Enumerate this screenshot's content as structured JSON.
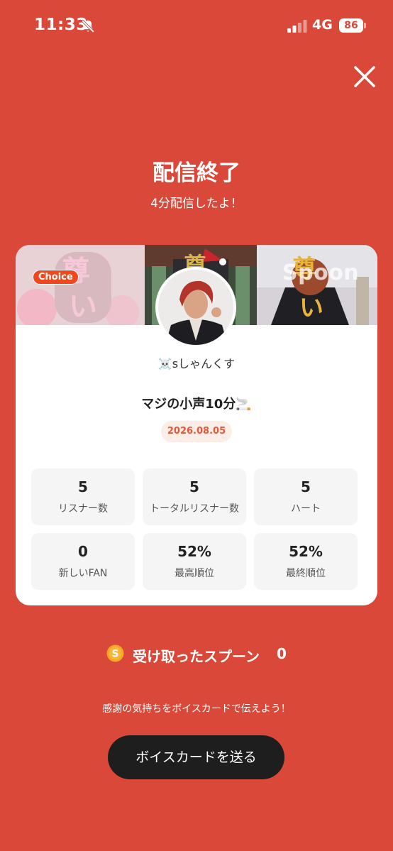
{
  "status_bar": {
    "time": "11:33",
    "network": "4G",
    "battery": "86"
  },
  "header": {
    "title": "配信終了",
    "subtitle": "4分配信したよ！"
  },
  "card": {
    "badge": "Choice",
    "banner_logo": "Spoon",
    "username": "☠️sしゃんくす",
    "broadcast_title": "マジの小声10分🚬",
    "date": "2026.08.05",
    "stats": [
      {
        "value": "5",
        "label": "リスナー数"
      },
      {
        "value": "5",
        "label": "トータルリスナー数"
      },
      {
        "value": "5",
        "label": "ハート"
      },
      {
        "value": "0",
        "label": "新しいFAN"
      },
      {
        "value": "52%",
        "label": "最高順位"
      },
      {
        "value": "52%",
        "label": "最終順位"
      }
    ]
  },
  "spoons": {
    "icon_letter": "S",
    "label": "受け取ったスプーン",
    "count": "0"
  },
  "footer": {
    "message": "感謝の気持ちをボイスカードで伝えよう！",
    "button_label": "ボイスカードを送る"
  },
  "colors": {
    "background": "#D94838",
    "accent": "#F0471E",
    "button": "#1E1E1E"
  },
  "icons": [
    "bell-slash-icon",
    "signal-icon",
    "battery-icon",
    "close-icon",
    "spoon-coin-icon"
  ]
}
